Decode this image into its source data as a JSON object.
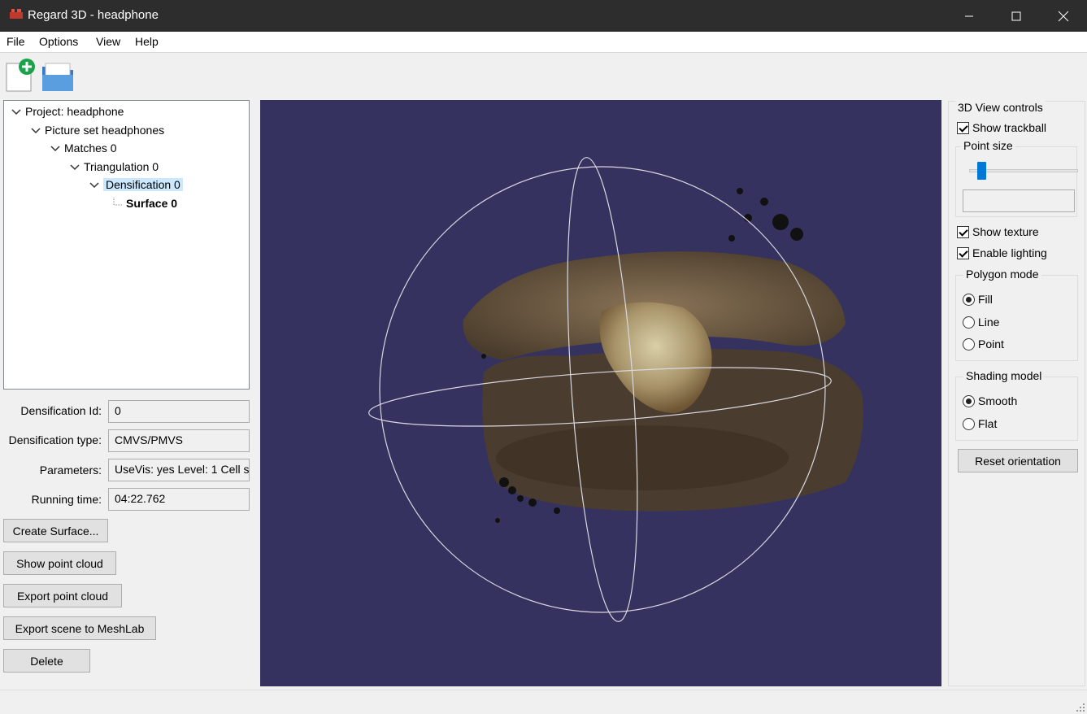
{
  "window": {
    "title": "Regard 3D - headphone"
  },
  "menu": [
    "File",
    "Options",
    "View",
    "Help"
  ],
  "tree": {
    "project": "Project: headphone",
    "picture_set": "Picture set headphones",
    "matches": "Matches 0",
    "triangulation": "Triangulation 0",
    "densification": "Densification 0",
    "surface": "Surface 0"
  },
  "properties": {
    "densification_id_label": "Densification Id:",
    "densification_id": "0",
    "densification_type_label": "Densification type:",
    "densification_type": "CMVS/PMVS",
    "parameters_label": "Parameters:",
    "parameters": "UseVis: yes Level: 1 Cell s",
    "running_time_label": "Running time:",
    "running_time": "04:22.762"
  },
  "buttons": {
    "create_surface": "Create Surface...",
    "show_point_cloud": "Show point cloud",
    "export_point_cloud": "Export point cloud",
    "export_meshlab": "Export scene to MeshLab",
    "delete": "Delete"
  },
  "view_controls": {
    "title": "3D View controls",
    "show_trackball": "Show trackball",
    "point_size": "Point size",
    "point_size_value": "",
    "show_texture": "Show texture",
    "enable_lighting": "Enable lighting",
    "polygon_mode": "Polygon mode",
    "polygon_options": [
      "Fill",
      "Line",
      "Point"
    ],
    "polygon_selected": "Fill",
    "shading_model": "Shading model",
    "shading_options": [
      "Smooth",
      "Flat"
    ],
    "shading_selected": "Smooth",
    "reset_orientation": "Reset orientation"
  },
  "colors": {
    "viewport_bg": "#353260",
    "selection": "#cce8ff",
    "titlebar": "#2d2d2d"
  }
}
